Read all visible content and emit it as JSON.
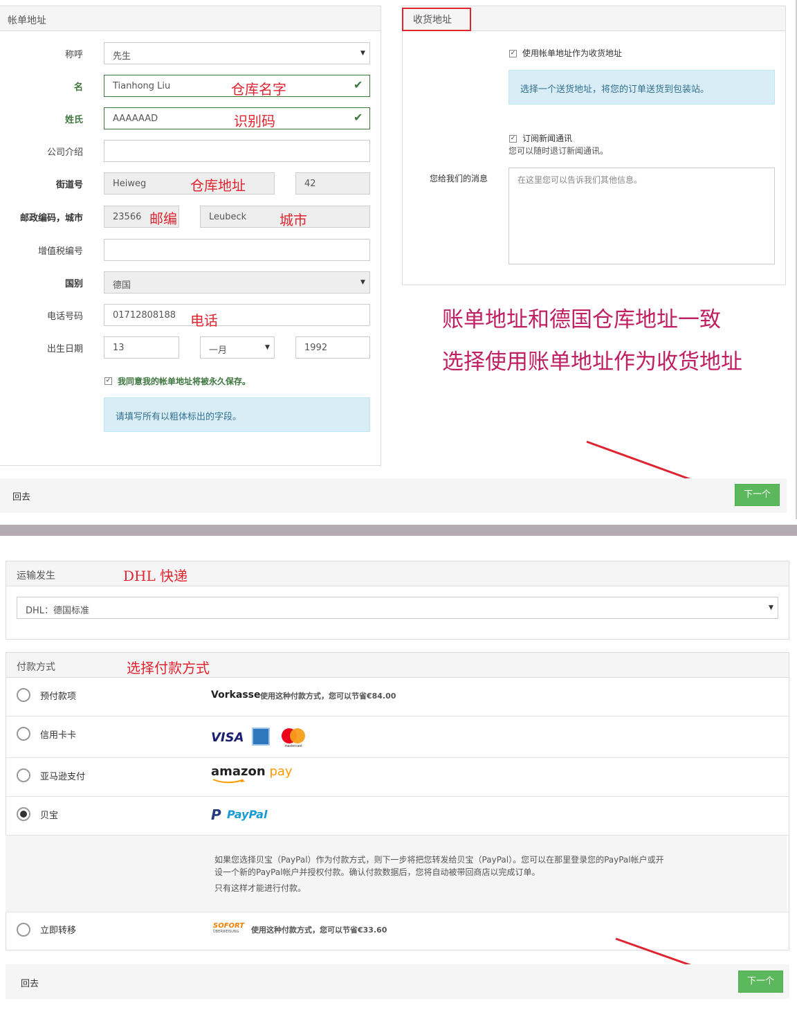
{
  "billing": {
    "title": "帐单地址",
    "salutation_label": "称呼",
    "salutation_value": "先生",
    "firstname_label": "名",
    "firstname_value": "Tianhong Liu",
    "firstname_note": "仓库名字",
    "lastname_label": "姓氏",
    "lastname_value": "AAAAAAD",
    "lastname_note": "识别码",
    "company_label": "公司介绍",
    "street_label": "街道号",
    "street_value": "Heiweg",
    "street_note": "仓库地址",
    "house_number": "42",
    "zip_city_label": "邮政编码，城市",
    "zip_value": "23566",
    "zip_note": "邮编",
    "city_value": "Leubeck",
    "city_note": "城市",
    "vat_label": "增值税编号",
    "country_label": "国别",
    "country_value": "德国",
    "phone_label": "电话号码",
    "phone_value": "01712808188",
    "phone_note": "电话",
    "birthday_label": "出生日期",
    "birth_day": "13",
    "birth_month": "一月",
    "birth_year": "1992",
    "save_label": "我同意我的帐单地址将被永久保存。",
    "required_info": "请填写所有以粗体标出的字段。"
  },
  "shipping": {
    "title": "收货地址",
    "use_billing_label": "使用帐单地址作为收货地址",
    "info": "选择一个送货地址，将您的订单送货到包装站。",
    "newsletter_label": "订阅新闻通讯",
    "newsletter_sub": "您可以随时退订新闻通讯。",
    "message_label": "您给我们的消息",
    "message_placeholder": "在这里您可以告诉我们其他信息。"
  },
  "annotation": {
    "line1": "账单地址和德国仓库地址一致",
    "line2": "选择使用账单地址作为收货地址"
  },
  "footer1": {
    "back": "回去",
    "next": "下一个"
  },
  "shipping_method": {
    "title": "运输发生",
    "note": "DHL  快递",
    "selected": "DHL：德国标准"
  },
  "payment": {
    "title": "付款方式",
    "note": "选择付款方式",
    "options": [
      {
        "label": "预付款项",
        "brand": "Vorkasse",
        "desc": "使用这种付款方式，您可以节省€84.00"
      },
      {
        "label": "信用卡卡",
        "brand_visa": "VISA",
        "brand_mc": "mastercard"
      },
      {
        "label": "亚马逊支付",
        "brand": "amazon",
        "brand2": "pay"
      },
      {
        "label": "贝宝",
        "brand": "PayPal"
      },
      {
        "label": "立即转移",
        "brand": "SOFORT",
        "brand_sub": "ÜBERWEISUNG",
        "desc": "使用这种付款方式，您可以节省€33.60"
      }
    ],
    "paypal_info_line1": "如果您选择贝宝（PayPal）作为付款方式，则下一步将把您转发给贝宝（PayPal）。您可以在那里登录您的PayPal帐户或开",
    "paypal_info_line2": "设一个新的PayPal帐户并授权付款。确认付款数据后，您将自动被带回商店以完成订单。",
    "paypal_info_line3": "只有这样才能进行付款。"
  },
  "footer2": {
    "back": "回去",
    "next": "下一个"
  },
  "colors": {
    "accent": "#5cb85c",
    "annotation_red": "#e0242f",
    "annotation_magenta": "#c01f63",
    "info_bg": "#d9edf7",
    "divider": "#b4acb0"
  }
}
